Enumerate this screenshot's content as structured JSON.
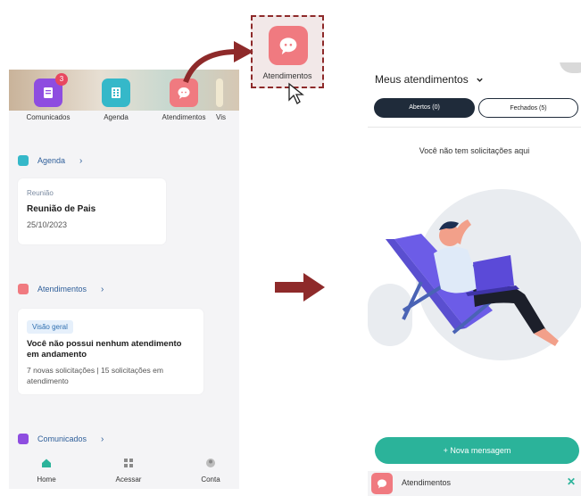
{
  "left": {
    "shortcuts": [
      {
        "label": "Comunicados",
        "badge": "3",
        "color": "#8e4de0",
        "icon": "document-icon"
      },
      {
        "label": "Agenda",
        "color": "#35b8c9",
        "icon": "calendar-grid-icon"
      },
      {
        "label": "Atendimentos",
        "color": "#f07a80",
        "icon": "chat-bubble-icon"
      },
      {
        "label": "Vis"
      }
    ],
    "agenda": {
      "title": "Agenda",
      "card_small": "Reunião",
      "card_title": "Reunião de Pais",
      "card_date": "25/10/2023"
    },
    "atendimentos": {
      "title": "Atendimentos",
      "chip": "Visão geral",
      "card_title": "Você não possui nenhum atendimento em andamento",
      "card_desc": "7 novas solicitações | 15 solicitações em atendimento"
    },
    "comunicados": {
      "title": "Comunicados"
    },
    "nav": {
      "home": "Home",
      "acessar": "Acessar",
      "conta": "Conta"
    }
  },
  "popup": {
    "label": "Atendimentos"
  },
  "right": {
    "title": "Meus atendimentos",
    "tab_open": "Abertos (0)",
    "tab_closed": "Fechados (5)",
    "empty": "Você não tem solicitações aqui",
    "new_message": "+ Nova mensagem",
    "footer_label": "Atendimentos",
    "close_symbol": "✕"
  },
  "colors": {
    "accent_teal": "#2bb39a",
    "dark_navy": "#1f2b3a",
    "arrow_red": "#8e2a2a"
  }
}
